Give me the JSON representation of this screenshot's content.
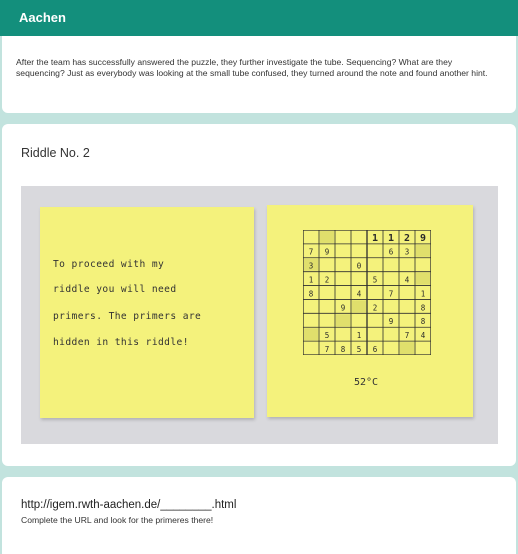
{
  "header": {
    "title": "Aachen"
  },
  "intro": {
    "text": "After the team has successfully answered the puzzle, they further investigate the tube. Sequencing? What are they sequencing? Just as everybody was looking at the small tube confused, they turned around the note and found another hint."
  },
  "riddle": {
    "title": "Riddle No. 2",
    "note_lines": [
      "To proceed with my",
      "riddle you will need",
      "primers. The primers are",
      "hidden in this riddle!"
    ],
    "temperature": "52°C",
    "grid": [
      [
        "",
        "",
        "",
        "",
        "1",
        "1",
        "2",
        "9"
      ],
      [
        "7",
        "9",
        "",
        "",
        "",
        "6",
        "3",
        ""
      ],
      [
        "3",
        "",
        "",
        "0",
        "",
        "",
        "",
        ""
      ],
      [
        "1",
        "2",
        "",
        "",
        "5",
        "",
        "4",
        ""
      ],
      [
        "8",
        "",
        "",
        "4",
        "",
        "7",
        "",
        "1"
      ],
      [
        "",
        "",
        "9",
        "",
        "2",
        "",
        "",
        "8"
      ],
      [
        "",
        "",
        "",
        "",
        "",
        "9",
        "",
        "8"
      ],
      [
        "",
        "5",
        "",
        "1",
        "",
        "",
        "7",
        "4"
      ],
      [
        "",
        "7",
        "8",
        "5",
        "6",
        "",
        "",
        ""
      ]
    ],
    "shaded_color": "#cfcf5e",
    "grid_line_color": "#2e2e2e"
  },
  "footer": {
    "url": "http://igem.rwth-aachen.de/________.html",
    "hint": "Complete the URL and look for the primeres there!"
  },
  "colors": {
    "header": "#138f7c",
    "page_background": "#c2e3de",
    "note": "#f4f27c"
  }
}
